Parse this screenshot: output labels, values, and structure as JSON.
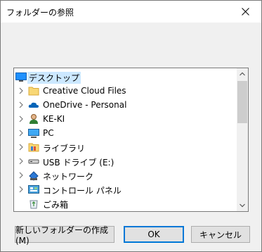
{
  "window": {
    "title": "フォルダーの参照",
    "close_glyph": "✕"
  },
  "tree": {
    "items": [
      {
        "label": "デスクトップ",
        "icon": "desktop-icon",
        "selected": true,
        "root": true
      },
      {
        "label": "Creative Cloud Files",
        "icon": "folder-icon"
      },
      {
        "label": "OneDrive - Personal",
        "icon": "onedrive-cloud-icon"
      },
      {
        "label": "KE-KI",
        "icon": "user-icon"
      },
      {
        "label": "PC",
        "icon": "computer-icon"
      },
      {
        "label": "ライブラリ",
        "icon": "library-icon"
      },
      {
        "label": "USB ドライブ (E:)",
        "icon": "usb-drive-icon"
      },
      {
        "label": "ネットワーク",
        "icon": "network-icon"
      },
      {
        "label": "コントロール パネル",
        "icon": "control-panel-icon"
      },
      {
        "label": "ごみ箱",
        "icon": "recycle-bin-icon"
      }
    ]
  },
  "buttons": {
    "new_folder": "新しいフォルダーの作成(M)",
    "ok": "OK",
    "cancel": "キャンセル"
  },
  "colors": {
    "accent": "#0078d7",
    "selection": "#cce8ff"
  }
}
